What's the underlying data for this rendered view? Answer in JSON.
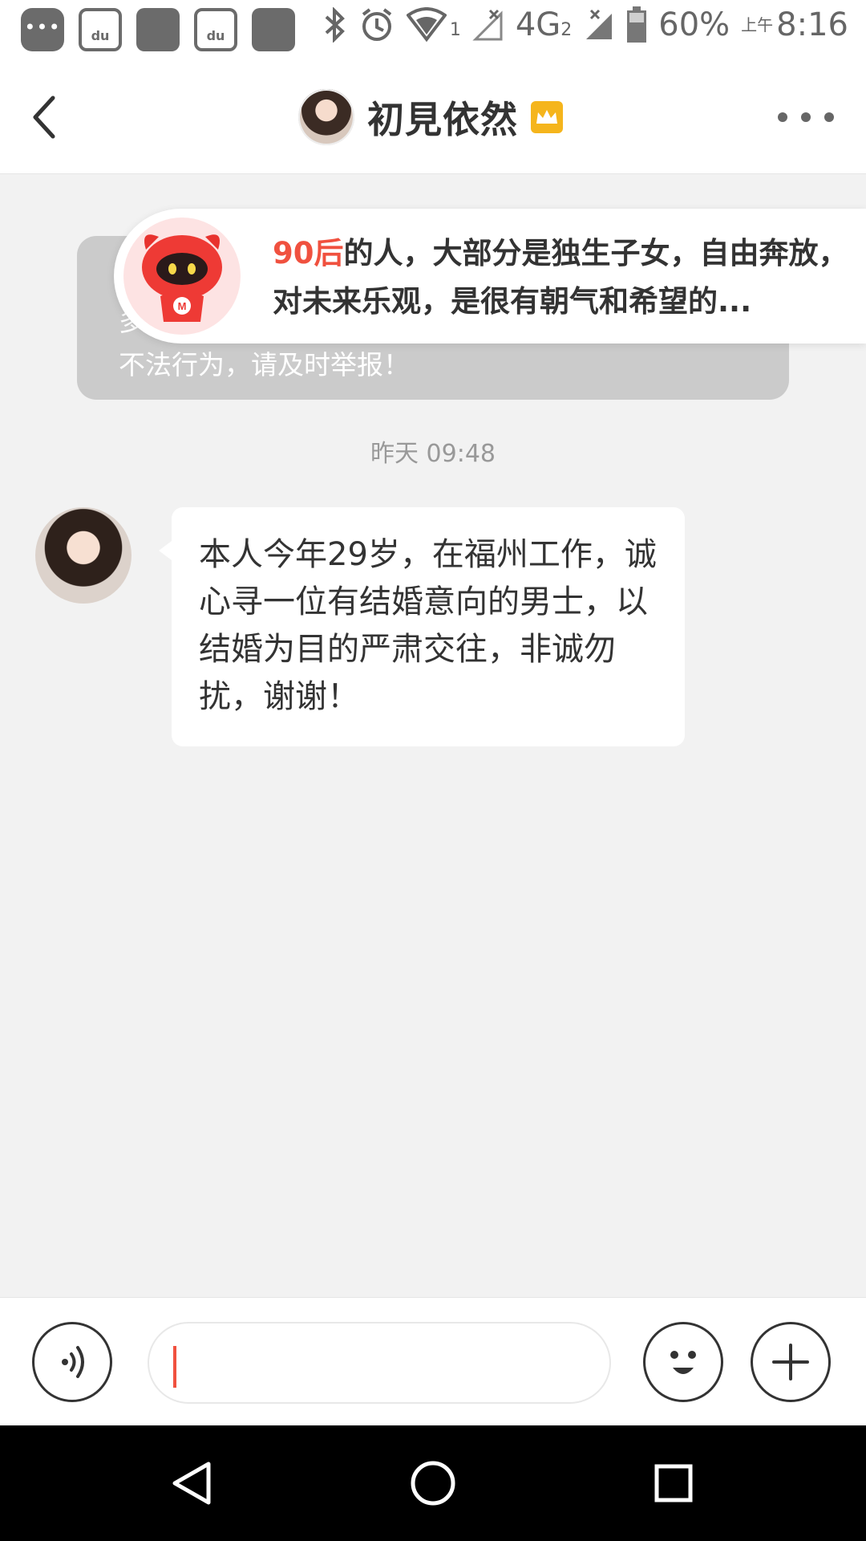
{
  "status_bar": {
    "battery": "60%",
    "ampm": "上午",
    "time": "8:16",
    "network": "4G",
    "sim1": "1",
    "sim2": "2"
  },
  "header": {
    "title": "初見依然"
  },
  "notice": {
    "visible_line": "不法行为，请及时举报！"
  },
  "popup": {
    "highlight": "90后",
    "text": "的人，大部分是独生子女，自由奔放，对未来乐观，是很有朝气和希望的..."
  },
  "chat": {
    "timestamp": "昨天 09:48",
    "message": "本人今年29岁，在福州工作，诚心寻一位有结婚意向的男士，以结婚为目的严肃交往，非诚勿扰，谢谢！"
  },
  "input": {
    "value": ""
  },
  "colors": {
    "accent": "#f0513f",
    "crown": "#f5b51c",
    "notice_bg": "#cbcbcb",
    "page_bg": "#f2f2f2"
  },
  "icons": [
    "message-icon",
    "baidu-icon",
    "bluetooth-icon",
    "alarm-icon",
    "wifi-icon",
    "signal-icon",
    "battery-icon",
    "back-arrow-icon",
    "crown-icon",
    "more-icon",
    "mascot-icon",
    "voice-icon",
    "emoji-icon",
    "plus-icon",
    "nav-back-icon",
    "nav-home-icon",
    "nav-recent-icon"
  ]
}
